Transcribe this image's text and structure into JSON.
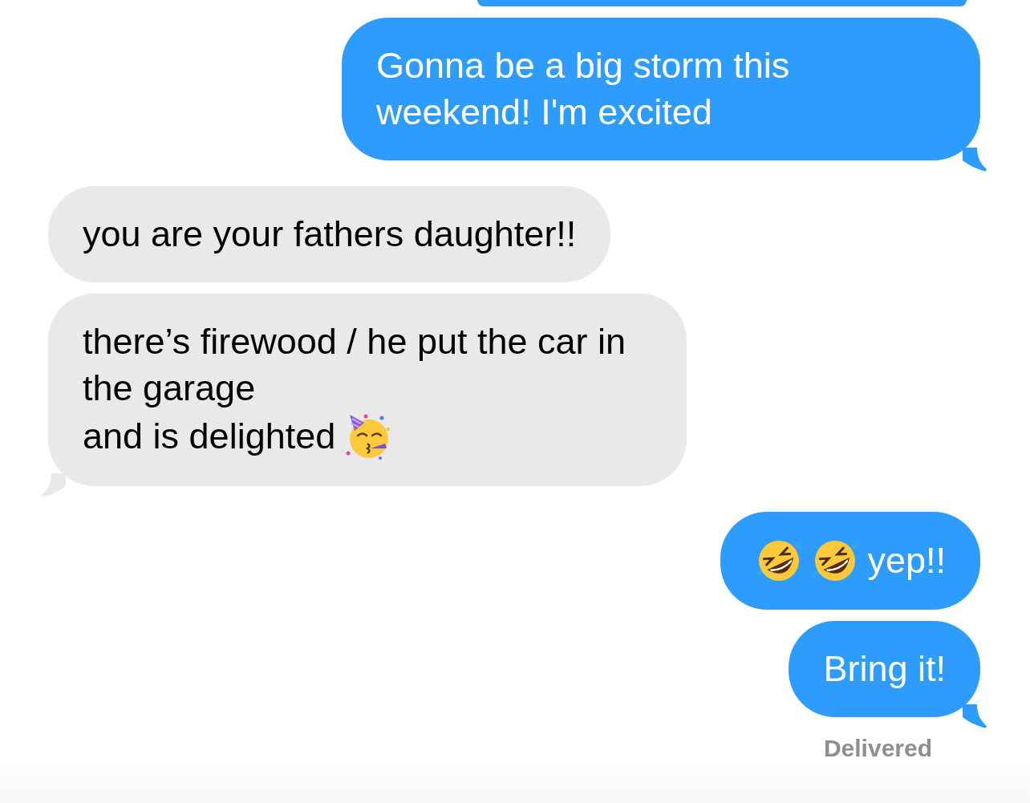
{
  "messages": [
    {
      "kind": "sent",
      "cut_off": true,
      "tail": false
    },
    {
      "kind": "sent",
      "cut_off": false,
      "tail": true,
      "lines": [
        [
          {
            "kind": "text",
            "text": "Gonna be a big storm this weekend! I'm excited"
          }
        ]
      ]
    },
    {
      "kind": "received",
      "cut_off": false,
      "tail": false,
      "lines": [
        [
          {
            "kind": "text",
            "text": "you are your fathers daughter!!"
          }
        ]
      ]
    },
    {
      "kind": "received",
      "cut_off": false,
      "tail": true,
      "lines": [
        [
          {
            "kind": "text",
            "text": "there’s firewood / he put the car in the garage"
          }
        ],
        [
          {
            "kind": "text",
            "text": "and is delighted"
          },
          {
            "kind": "party-emoji"
          }
        ]
      ]
    },
    {
      "kind": "sent",
      "cut_off": false,
      "tail": false,
      "lines": [
        [
          {
            "kind": "laugh-emoji"
          },
          {
            "kind": "laugh-emoji"
          },
          {
            "kind": "text",
            "text": "yep!!"
          }
        ]
      ]
    },
    {
      "kind": "sent",
      "cut_off": false,
      "tail": true,
      "lines": [
        [
          {
            "kind": "text",
            "text": "Bring it!"
          }
        ]
      ]
    }
  ],
  "status": "Delivered"
}
